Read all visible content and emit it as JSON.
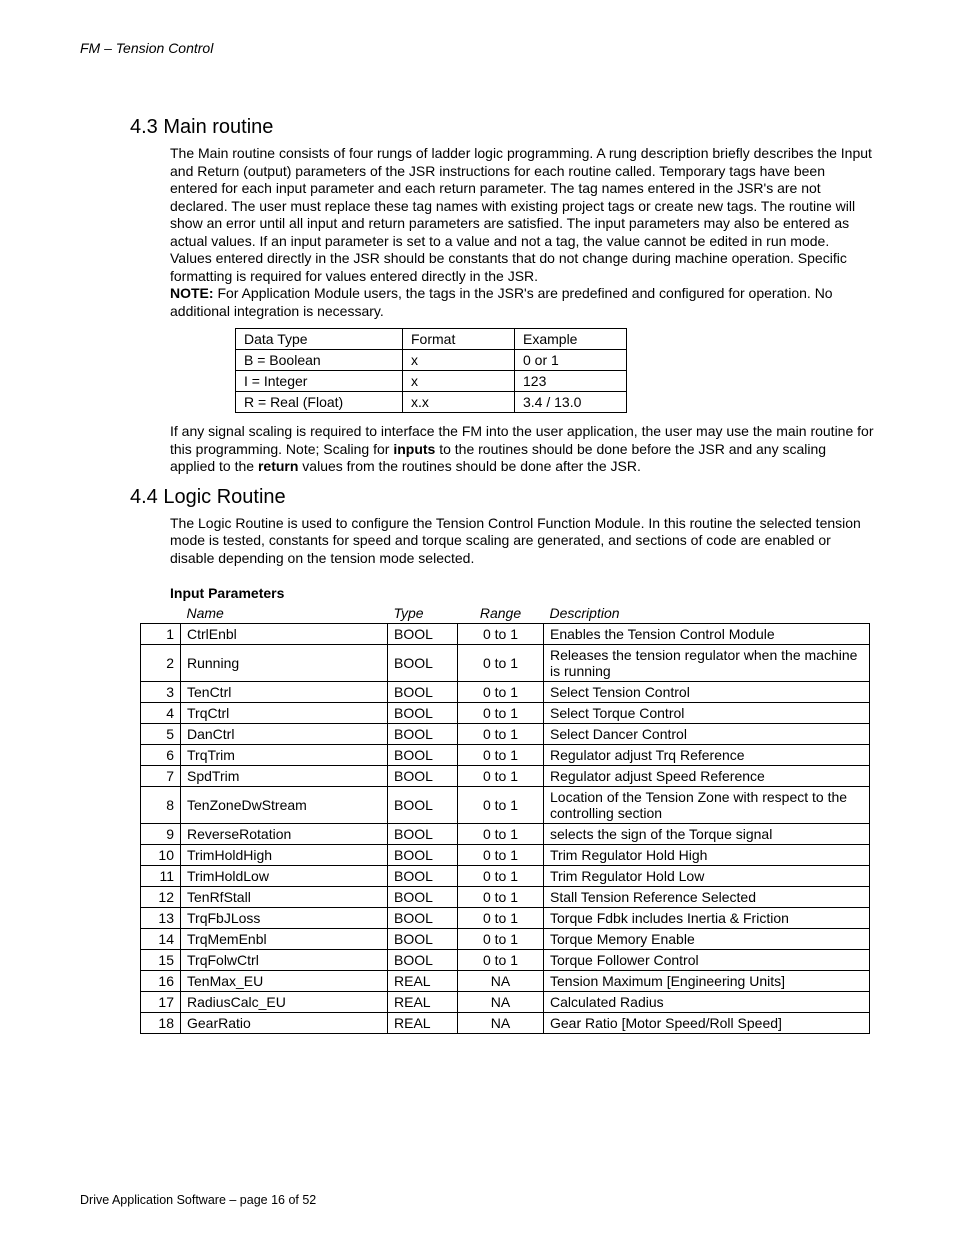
{
  "header": "FM – Tension Control",
  "footer": "Drive Application Software – page 16 of 52",
  "section43": {
    "heading": "4.3  Main routine",
    "para1": "The Main routine consists of four rungs of ladder logic programming.  A rung description briefly describes the Input and Return (output) parameters of the JSR instructions for each routine called.  Temporary tags have been entered for each input parameter and each return parameter.  The tag names entered in the JSR's are not declared.  The user must replace these tag names with existing project tags or create new tags.  The routine will show an error until all input and return parameters are satisfied.  The input parameters may also be entered as actual values.  If an input parameter is set to a value and not a tag, the value cannot be edited in run mode.  Values entered directly in the JSR should be constants that do not change during machine operation.  Specific formatting is required for values entered directly in the JSR.",
    "note_label": "NOTE:",
    "note_text": " For Application Module users, the tags in the JSR's are predefined and configured for operation.  No additional integration is necessary.",
    "dt_table": {
      "headers": [
        "Data Type",
        "Format",
        "Example"
      ],
      "rows": [
        [
          "B = Boolean",
          "x",
          "0 or 1"
        ],
        [
          "I = Integer",
          "x",
          "123"
        ],
        [
          "R = Real (Float)",
          "x.x",
          "3.4 / 13.0"
        ]
      ]
    },
    "para2_pre": "If any signal scaling is required to interface the FM into the user application, the user may use the main routine for this programming.  Note; Scaling for ",
    "para2_b1": "inputs",
    "para2_mid": " to the routines should be done before the JSR and any scaling applied to the ",
    "para2_b2": "return",
    "para2_post": " values from the routines should be done after the JSR."
  },
  "section44": {
    "heading": "4.4  Logic Routine",
    "para1": "The Logic Routine is used to configure the Tension Control Function Module.  In this routine the selected tension mode is tested, constants for speed and torque scaling are generated, and sections of code are enabled or disable depending on the tension mode selected.",
    "sub_heading": "Input Parameters",
    "params_headers": [
      "",
      "Name",
      "Type",
      "Range",
      "Description"
    ],
    "params": [
      {
        "n": "1",
        "name": "CtrlEnbl",
        "type": "BOOL",
        "range": "0 to 1",
        "desc": "Enables the Tension Control Module"
      },
      {
        "n": "2",
        "name": "Running",
        "type": "BOOL",
        "range": "0 to 1",
        "desc": "Releases the tension regulator when the machine is running"
      },
      {
        "n": "3",
        "name": "TenCtrl",
        "type": "BOOL",
        "range": "0 to 1",
        "desc": "Select Tension Control"
      },
      {
        "n": "4",
        "name": "TrqCtrl",
        "type": "BOOL",
        "range": "0 to 1",
        "desc": "Select Torque Control"
      },
      {
        "n": "5",
        "name": "DanCtrl",
        "type": "BOOL",
        "range": "0 to 1",
        "desc": "Select Dancer Control"
      },
      {
        "n": "6",
        "name": "TrqTrim",
        "type": "BOOL",
        "range": "0 to 1",
        "desc": "Regulator adjust Trq Reference"
      },
      {
        "n": "7",
        "name": "SpdTrim",
        "type": "BOOL",
        "range": "0 to 1",
        "desc": "Regulator adjust Speed Reference"
      },
      {
        "n": "8",
        "name": "TenZoneDwStream",
        "type": "BOOL",
        "range": "0 to 1",
        "desc": "Location of the Tension Zone with respect to the controlling section"
      },
      {
        "n": "9",
        "name": "ReverseRotation",
        "type": "BOOL",
        "range": "0 to 1",
        "desc": "selects the sign of the Torque signal"
      },
      {
        "n": "10",
        "name": "TrimHoldHigh",
        "type": "BOOL",
        "range": "0 to 1",
        "desc": "Trim Regulator Hold High"
      },
      {
        "n": "11",
        "name": "TrimHoldLow",
        "type": "BOOL",
        "range": "0 to 1",
        "desc": "Trim Regulator Hold Low"
      },
      {
        "n": "12",
        "name": "TenRfStall",
        "type": "BOOL",
        "range": "0 to 1",
        "desc": "Stall Tension Reference Selected"
      },
      {
        "n": "13",
        "name": "TrqFbJLoss",
        "type": "BOOL",
        "range": "0 to 1",
        "desc": "Torque Fdbk includes Inertia & Friction"
      },
      {
        "n": "14",
        "name": "TrqMemEnbl",
        "type": "BOOL",
        "range": "0 to 1",
        "desc": "Torque Memory Enable"
      },
      {
        "n": "15",
        "name": "TrqFolwCtrl",
        "type": "BOOL",
        "range": "0 to 1",
        "desc": "Torque Follower Control"
      },
      {
        "n": "16",
        "name": "TenMax_EU",
        "type": "REAL",
        "range": "NA",
        "desc": "Tension Maximum [Engineering Units]"
      },
      {
        "n": "17",
        "name": "RadiusCalc_EU",
        "type": "REAL",
        "range": "NA",
        "desc": "Calculated Radius"
      },
      {
        "n": "18",
        "name": "GearRatio",
        "type": "REAL",
        "range": "NA",
        "desc": "Gear Ratio [Motor Speed/Roll Speed]"
      }
    ]
  }
}
